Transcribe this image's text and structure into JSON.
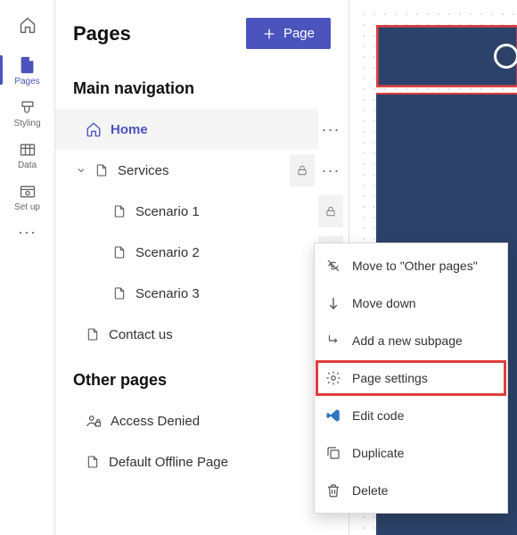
{
  "rail": {
    "items": [
      {
        "id": "pages",
        "label": "Pages"
      },
      {
        "id": "styling",
        "label": "Styling"
      },
      {
        "id": "data",
        "label": "Data"
      },
      {
        "id": "setup",
        "label": "Set up"
      }
    ]
  },
  "sidebar": {
    "title": "Pages",
    "new_page_button": "Page",
    "main_nav_heading": "Main navigation",
    "other_pages_heading": "Other pages",
    "main_nav": {
      "home": "Home",
      "services": "Services",
      "scenario1": "Scenario 1",
      "scenario2": "Scenario 2",
      "scenario3": "Scenario 3",
      "contact": "Contact us"
    },
    "other_pages": {
      "access_denied": "Access Denied",
      "default_offline": "Default Offline Page"
    }
  },
  "context_menu": {
    "move_to_other": "Move to \"Other pages\"",
    "move_down": "Move down",
    "add_subpage": "Add a new subpage",
    "page_settings": "Page settings",
    "edit_code": "Edit code",
    "duplicate": "Duplicate",
    "delete": "Delete"
  }
}
